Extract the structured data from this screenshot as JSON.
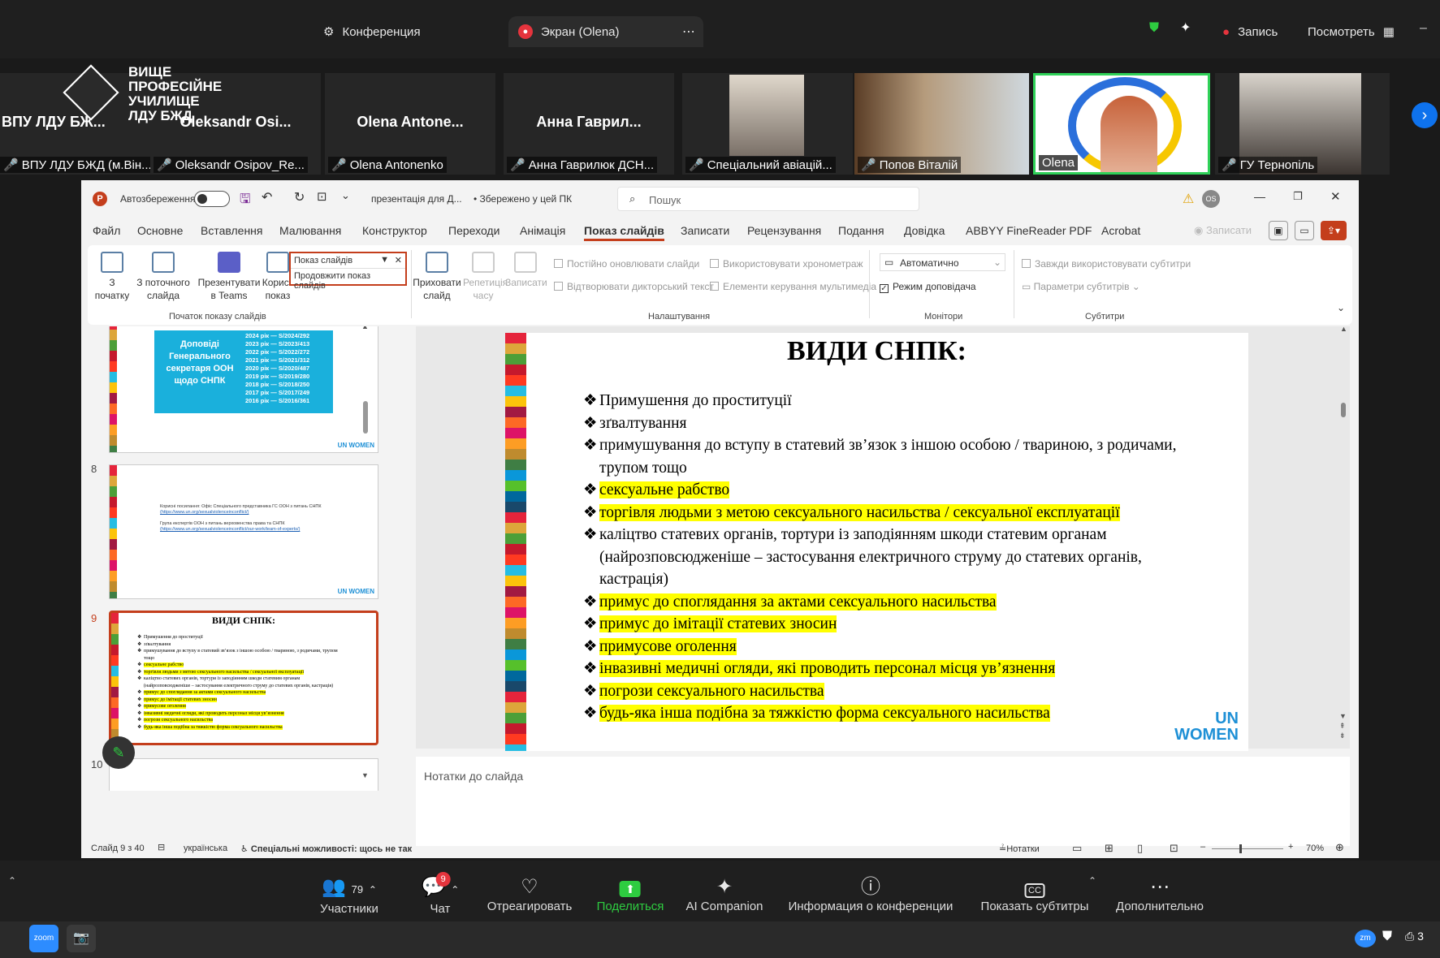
{
  "zoom_top": {
    "tab1": "Конференция",
    "tab2": "Экран (Olena)",
    "record": "Запись",
    "view": "Посмотреть"
  },
  "participants": [
    {
      "name": "ВПУ ЛДУ БЖ...",
      "label": "ВПУ ЛДУ БЖД (м.Він..."
    },
    {
      "name": "Oleksandr Osi...",
      "label": "Oleksandr Osipov_Re..."
    },
    {
      "name": "Olena Antone...",
      "label": "Olena Antonenko"
    },
    {
      "name": "Анна Гаврил...",
      "label": "Анна Гаврилюк ДСН..."
    },
    {
      "name": "",
      "label": "Спеціальний авіацій..."
    },
    {
      "name": "",
      "label": "Попов Віталій"
    },
    {
      "name": "",
      "label": "Olena"
    },
    {
      "name": "",
      "label": "ГУ Тернопіль"
    }
  ],
  "logo_text": [
    "ВИЩЕ",
    "ПРОФЕСІЙНЕ",
    "УЧИЛИЩЕ",
    "ЛДУ БЖД"
  ],
  "ppt": {
    "autosave": "Автозбереження",
    "filename": "презентація для Д...",
    "saved": "• Збережено у цей ПК",
    "search": "Пошук",
    "user_initials": "OS",
    "menu": [
      "Файл",
      "Основне",
      "Вставлення",
      "Малювання",
      "Конструктор",
      "Переходи",
      "Анімація",
      "Показ слайдів",
      "Записати",
      "Рецензування",
      "Подання",
      "Довідка",
      "ABBYY FineReader PDF",
      "Acrobat"
    ],
    "record_btn": "Записати",
    "ribbon": {
      "from_start": "З початку",
      "from_current": "З поточного слайда",
      "present_teams": "Презентувати в Teams",
      "custom_show": "Корист показ",
      "popup_title": "Показ слайдів",
      "popup_item": "Продовжити показ слайдів",
      "hide_slide": "Приховати слайд",
      "rehearse": "Репетиція часу",
      "record": "Записати",
      "group_start": "Початок показу слайдів",
      "opt1": "Постійно оновлювати слайди",
      "opt2": "Відтворювати дикторський текст",
      "opt3": "Використовувати хронометраж",
      "opt4": "Елементи керування мультимедіа",
      "group_setup": "Налаштування",
      "monitor_value": "Автоматично",
      "presenter_view": "Режим доповідача",
      "group_monitors": "Монітори",
      "subs1": "Завжди використовувати субтитри",
      "subs2": "Параметри субтитрів",
      "group_subs": "Субтитри"
    },
    "thumb_numbers": [
      "8",
      "9",
      "10"
    ],
    "thumb7": {
      "title": "Доповіді Генерального секретаря ООН щодо СНПК",
      "list": [
        "2024 рік — S/2024/292",
        "2023 рік — S/2023/413",
        "2022 рік — S/2022/272",
        "2021 рік — S/2021/312",
        "2020 рік — S/2020/487",
        "2019 рік — S/2019/280",
        "2018 рік — S/2018/250",
        "2017 рік — S/2017/249",
        "2016 рік — S/2016/361"
      ]
    },
    "thumb8_lines": [
      "Корисні посилання: Офіс Спеціального представника ГС ООН з питань СНПК",
      "(https://www.un.org/sexualviolenceinconflict/)",
      "Група експертів ООН з питань верховенства права та СНПК",
      "(https://www.un.org/sexualviolenceinconflict/our-work/team-of-experts/)"
    ],
    "slide": {
      "title": "ВИДИ СНПК:",
      "bullets": [
        {
          "text": "Примушення до проституції",
          "hl": false
        },
        {
          "text": "зґвалтування",
          "hl": false
        },
        {
          "text": "примушування до вступу в статевий зв’язок з іншою особою / твариною, з родичами, трупом тощо",
          "hl": false
        },
        {
          "text": "сексуальне рабство",
          "hl": true
        },
        {
          "text": "торгівля людьми з метою сексуального насильства / сексуальної експлуатації",
          "hl": true
        },
        {
          "text": "каліцтво статевих органів, тортури із заподіянням шкоди статевим органам (найрозповсюдженіше – застосування електричного струму до статевих органів, кастрація)",
          "hl": false
        },
        {
          "text": "примус до споглядання за актами сексуального насильства",
          "hl": true
        },
        {
          "text": "примус до імітації статевих зносин",
          "hl": true
        },
        {
          "text": "примусове оголення",
          "hl": true
        },
        {
          "text": "інвазивні медичні огляди, які проводить персонал місця ув’язнення",
          "hl": true
        },
        {
          "text": "погрози сексуального насильства",
          "hl": true
        },
        {
          "text": "будь-яка інша подібна за тяжкістю форма сексуального насильства",
          "hl": true
        }
      ],
      "logo": "UN WOMEN"
    },
    "notes_placeholder": "Нотатки до слайда",
    "status": {
      "slide": "Слайд 9 з 40",
      "lang": "українська",
      "access": "Спеціальні можливості: щось не так",
      "notes": "Нотатки",
      "zoom": "70%"
    }
  },
  "zoom_bottom": {
    "participants": "Участники",
    "participants_count": "79",
    "chat": "Чат",
    "chat_badge": "9",
    "react": "Отреагировать",
    "share": "Поделиться",
    "ai": "AI Companion",
    "info": "Информация о конференции",
    "captions": "Показать субтитры",
    "more": "Дополнительно"
  },
  "taskbar": {
    "zoom": "zoom",
    "right": "3"
  }
}
